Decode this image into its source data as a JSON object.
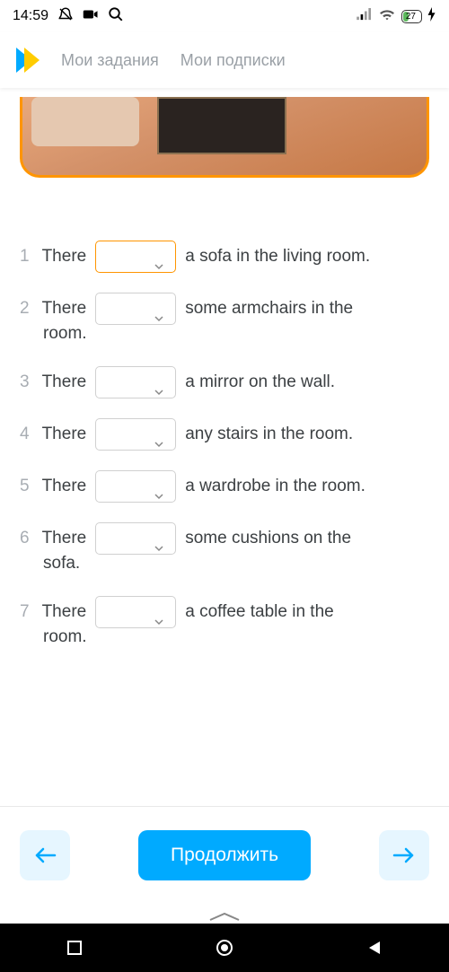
{
  "status": {
    "time": "14:59",
    "battery": "27"
  },
  "header": {
    "nav1": "Мои задания",
    "nav2": "Мои подписки"
  },
  "questions": [
    {
      "num": "1",
      "before": "There",
      "after": "a sofa in the living room.",
      "wrap": "",
      "active": true
    },
    {
      "num": "2",
      "before": "There",
      "after": "some armchairs in the",
      "wrap": "room.",
      "active": false
    },
    {
      "num": "3",
      "before": "There",
      "after": "a mirror on the wall.",
      "wrap": "",
      "active": false
    },
    {
      "num": "4",
      "before": "There",
      "after": "any stairs in the room.",
      "wrap": "",
      "active": false
    },
    {
      "num": "5",
      "before": "There",
      "after": "a wardrobe in the room.",
      "wrap": "",
      "active": false
    },
    {
      "num": "6",
      "before": "There",
      "after": "some cushions on the",
      "wrap": "sofa.",
      "active": false
    },
    {
      "num": "7",
      "before": "There",
      "after": "a coffee table in the",
      "wrap": "room.",
      "active": false
    }
  ],
  "footer": {
    "continue": "Продолжить"
  }
}
